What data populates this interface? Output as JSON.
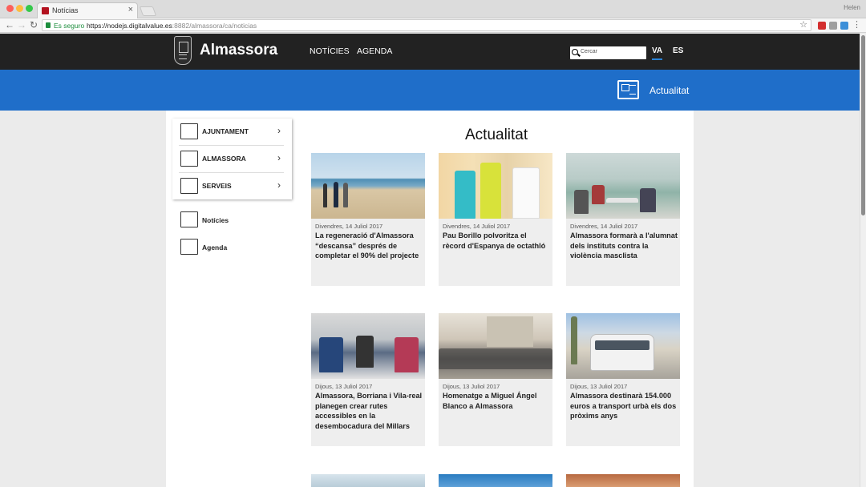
{
  "browser": {
    "tab_title": "Notícias",
    "profile": "Helen",
    "secure_label": "Es seguro",
    "url_host": "https://nodejs.digitalvalue.es",
    "url_path": ":8882/almassora/ca/noticias"
  },
  "header": {
    "site_title": "Almassora",
    "nav": [
      "NOTÍCIES",
      "AGENDA"
    ],
    "search_placeholder": "Cercar",
    "languages": [
      "VA",
      "ES"
    ],
    "active_language": "VA"
  },
  "band": {
    "title": "Actualitat"
  },
  "sidebar": {
    "menu": [
      {
        "label": "AJUNTAMENT",
        "icon": "town-hall-icon"
      },
      {
        "label": "ALMASSORA",
        "icon": "city-icon"
      },
      {
        "label": "SERVEIS",
        "icon": "hand-services-icon"
      }
    ],
    "links": [
      {
        "label": "Notícies",
        "icon": "newspaper-icon"
      },
      {
        "label": "Agenda",
        "icon": "calendar-icon"
      }
    ]
  },
  "main": {
    "title": "Actualitat",
    "cards": [
      {
        "date": "Divendres, 14 Juliol 2017",
        "title": "La regeneració d'Almassora “descansa” després de completar el 90% del projecte"
      },
      {
        "date": "Divendres, 14 Juliol 2017",
        "title": "Pau Borillo polvoritza el rècord d'Espanya de octathló"
      },
      {
        "date": "Divendres, 14 Juliol 2017",
        "title": "Almassora formarà a l'alumnat dels instituts contra la violència masclista"
      },
      {
        "date": "Dijous, 13 Juliol 2017",
        "title": "Almassora, Borriana i Vila-real planegen crear rutes accessibles en la desembocadura del Millars"
      },
      {
        "date": "Dijous, 13 Juliol 2017",
        "title": "Homenatge a Miguel Ángel Blanco a Almassora"
      },
      {
        "date": "Dijous, 13 Juliol 2017",
        "title": "Almassora destinarà 154.000 euros a transport urbà els dos pròxims anys"
      }
    ]
  }
}
